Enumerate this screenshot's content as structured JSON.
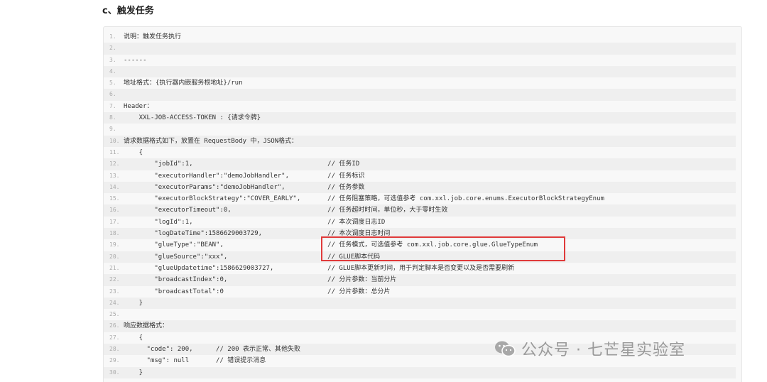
{
  "heading": "c、触发任务",
  "code_lines": [
    {
      "n": "1.",
      "text": "说明：触发任务执行"
    },
    {
      "n": "2.",
      "text": ""
    },
    {
      "n": "3.",
      "text": "------"
    },
    {
      "n": "4.",
      "text": ""
    },
    {
      "n": "5.",
      "text": "地址格式：{执行器内嵌服务根地址}/run"
    },
    {
      "n": "6.",
      "text": ""
    },
    {
      "n": "7.",
      "text": "Header："
    },
    {
      "n": "8.",
      "text": "    XXL-JOB-ACCESS-TOKEN : {请求令牌}"
    },
    {
      "n": "9.",
      "text": ""
    },
    {
      "n": "10.",
      "text": "请求数据格式如下，放置在 RequestBody 中，JSON格式："
    },
    {
      "n": "11.",
      "text": "    {"
    },
    {
      "n": "12.",
      "text": "        \"jobId\":1,                                   // 任务ID"
    },
    {
      "n": "13.",
      "text": "        \"executorHandler\":\"demoJobHandler\",          // 任务标识"
    },
    {
      "n": "14.",
      "text": "        \"executorParams\":\"demoJobHandler\",           // 任务参数"
    },
    {
      "n": "15.",
      "text": "        \"executorBlockStrategy\":\"COVER_EARLY\",       // 任务阻塞策略，可选值参考 com.xxl.job.core.enums.ExecutorBlockStrategyEnum"
    },
    {
      "n": "16.",
      "text": "        \"executorTimeout\":0,                         // 任务超时时间，单位秒，大于零时生效"
    },
    {
      "n": "17.",
      "text": "        \"logId\":1,                                   // 本次调度日志ID"
    },
    {
      "n": "18.",
      "text": "        \"logDateTime\":1586629003729,                 // 本次调度日志时间"
    },
    {
      "n": "19.",
      "text": "        \"glueType\":\"BEAN\",                           // 任务模式，可选值参考 com.xxl.job.core.glue.GlueTypeEnum"
    },
    {
      "n": "20.",
      "text": "        \"glueSource\":\"xxx\",                          // GLUE脚本代码"
    },
    {
      "n": "21.",
      "text": "        \"glueUpdatetime\":1586629003727,              // GLUE脚本更新时间，用于判定脚本是否变更以及是否需要刷新"
    },
    {
      "n": "22.",
      "text": "        \"broadcastIndex\":0,                          // 分片参数：当前分片"
    },
    {
      "n": "23.",
      "text": "        \"broadcastTotal\":0                           // 分片参数：总分片"
    },
    {
      "n": "24.",
      "text": "    }"
    },
    {
      "n": "25.",
      "text": ""
    },
    {
      "n": "26.",
      "text": "响应数据格式："
    },
    {
      "n": "27.",
      "text": "    {"
    },
    {
      "n": "28.",
      "text": "      \"code\": 200,      // 200 表示正常、其他失败"
    },
    {
      "n": "29.",
      "text": "      \"msg\": null       // 错误提示消息"
    },
    {
      "n": "30.",
      "text": "    }"
    }
  ],
  "watermark": "公众号 · 七芒星实验室",
  "colors": {
    "highlight_border": "#e03a3a",
    "code_background": "#f8f8f8",
    "watermark": "#9a9a9a"
  }
}
